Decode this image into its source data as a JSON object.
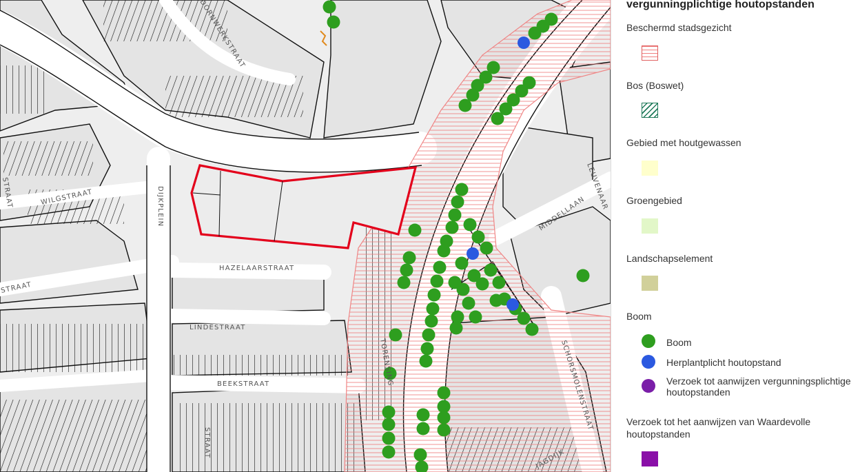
{
  "legend": {
    "heading": "vergunningplichtige houtopstanden",
    "sections": [
      {
        "id": "beschermd",
        "title": "Beschermd stadsgezicht",
        "color": "#f08080",
        "pattern": "horizontal-hatch"
      },
      {
        "id": "bos",
        "title": "Bos (Boswet)",
        "color": "#1f7a5a",
        "pattern": "diagonal-hatch"
      },
      {
        "id": "houtgewassen",
        "title": "Gebied met houtgewassen",
        "color": "#ffffcc",
        "pattern": "solid"
      },
      {
        "id": "groengebied",
        "title": "Groengebied",
        "color": "#e2f7c8",
        "pattern": "solid"
      },
      {
        "id": "landschapselement",
        "title": "Landschapselement",
        "color": "#d1d09a",
        "pattern": "solid"
      }
    ],
    "boom_section": {
      "title": "Boom",
      "items": [
        {
          "label": "Boom",
          "color": "#2e9e1f"
        },
        {
          "label": "Herplantplicht houtopstand",
          "color": "#2b59e0"
        },
        {
          "label": "Verzoek tot aanwijzen vergunningsplichtige houtopstanden",
          "color": "#7a1ea8"
        }
      ]
    },
    "waardevolle_section": {
      "title": "Verzoek tot het aanwijzen van Waardevolle houtopstanden",
      "color": "#8a0fa8"
    }
  },
  "map": {
    "street_labels": [
      "DORNWERKSTRAAT",
      "WILGSTRAAT",
      "HAZELAARSTRAAT",
      "LINDESTRAAT",
      "BEEKSTRAAT",
      "DIJKPLEIN",
      "MIDDELLAAN",
      "LEUVENAAR",
      "SCHORSMOLENSTRAAT",
      "TORENSING",
      "STRAAT",
      "STRAAT",
      "STRAAT",
      "JAGDIJK"
    ],
    "colors": {
      "background": "#eeeeee",
      "road": "#ffffff",
      "building": "#e6e6e6",
      "outline": "#111111",
      "selection": "#e3001b",
      "protected_hatch": "#f08080",
      "tree": "#2e9e1f",
      "replant": "#2b59e0"
    }
  }
}
